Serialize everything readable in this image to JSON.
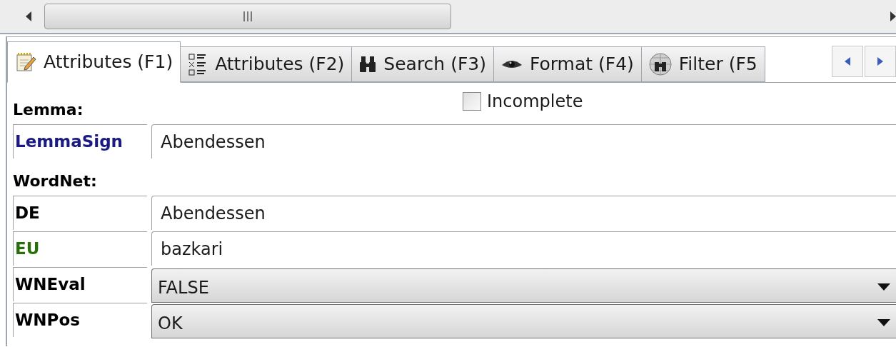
{
  "tabs": [
    {
      "label": "Attributes (F1)",
      "kind": "notepad",
      "selected": true
    },
    {
      "label": "Attributes (F2)",
      "kind": "checklist",
      "selected": false
    },
    {
      "label": "Search (F3)",
      "kind": "binoculars",
      "selected": false
    },
    {
      "label": "Format (F4)",
      "kind": "eye",
      "selected": false
    },
    {
      "label": "Filter (F5",
      "kind": "globe",
      "selected": false
    }
  ],
  "incomplete": {
    "label": "Incomplete",
    "checked": false
  },
  "sections": [
    {
      "title": "Lemma:",
      "fields": [
        {
          "label": "LemmaSign",
          "color": "#1a1a80",
          "kind": "text",
          "value": "Abendessen"
        }
      ]
    },
    {
      "title": "WordNet:",
      "fields": [
        {
          "label": "DE",
          "color": "#000000",
          "kind": "text",
          "value": "Abendessen"
        },
        {
          "label": "EU",
          "color": "#2a6e0a",
          "kind": "text",
          "value": "bazkari"
        },
        {
          "label": "WNEval",
          "color": "#000000",
          "kind": "dropdown",
          "value": "FALSE"
        },
        {
          "label": "WNPos",
          "color": "#000000",
          "kind": "dropdown",
          "value": "OK"
        }
      ]
    }
  ]
}
